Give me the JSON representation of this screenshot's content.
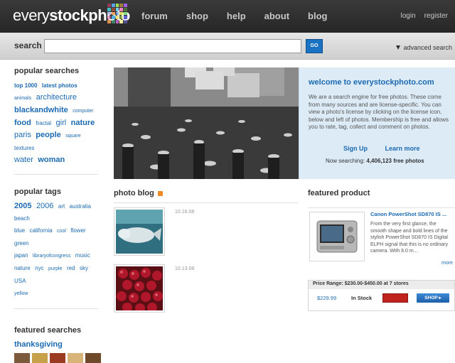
{
  "header": {
    "logo_light": "every",
    "logo_bold": "stockphoto",
    "nav": [
      "forum",
      "shop",
      "help",
      "about",
      "blog"
    ],
    "login": "login",
    "register": "register",
    "mosaic_colors": [
      "#e0407a",
      "#5aa0e8",
      "#9be05a",
      "#f0c040",
      "#a060e0",
      "#40c0c0",
      "#e06040",
      "#7ad0f0",
      "#f080c0",
      "#60a040",
      "#c0c0f0",
      "#f0a060",
      "#4080e0",
      "#e0e060",
      "#80e080",
      "#d050a0",
      "#50b0e0",
      "#f0e080",
      "#a0d040",
      "#6060d0",
      "#e09050",
      "#50d0a0",
      "#c060c0",
      "#f0f0a0",
      "#7070e0"
    ]
  },
  "search": {
    "label": "search",
    "value": "",
    "go": "GO",
    "advanced": "advanced search"
  },
  "sidebar": {
    "popular_searches_title": "popular searches",
    "popular_tags_title": "popular tags",
    "featured_searches_title": "featured searches",
    "featured_search": "thanksgiving"
  },
  "welcome": {
    "title": "welcome to everystockphoto.com",
    "body": "We are a search engine for free photos. These come from many sources and are license-specific. You can view a photo's license by clicking on the license icon, below and left of photos. Membership is free and allows you to rate, tag, collect and comment on photos.",
    "signup": "Sign Up",
    "learn_more": "Learn more",
    "searching_label": "Now searching:",
    "searching_count": "4,406,123 free photos"
  },
  "photo_blog": {
    "title": "photo blog",
    "entries": [
      {
        "date": "10.16.08"
      },
      {
        "date": "10.13.08"
      }
    ]
  },
  "featured_product": {
    "title": "featured product",
    "name": "Canon PowerShot SD870 IS ...",
    "description": "From the very first glance, the smooth shape and bold lines of the stylish PowerShot SD870 IS Digital ELPH signal that this is no ordinary camera. With 8.0 m...",
    "more": "more",
    "price_range": "Price Range: $230.00-$450.00 at 7 stores",
    "price": "$229.99",
    "stock": "In Stock",
    "shop": "SHOP"
  }
}
